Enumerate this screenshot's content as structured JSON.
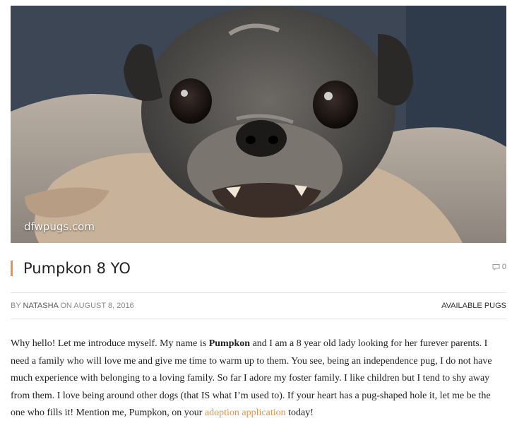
{
  "hero": {
    "watermark": "dfwpugs.com"
  },
  "post": {
    "title": "Pumpkon 8 YO",
    "comment_count": "0",
    "meta": {
      "by_label": "BY",
      "author": "NATASHA",
      "on_label": "ON",
      "date": "AUGUST 8, 2016",
      "category": "AVAILABLE PUGS"
    },
    "body": {
      "part1": "Why hello! Let me introduce myself. My name is ",
      "name_bold": "Pumpkon",
      "part2": " and I am a 8 year old lady looking for her furever parents. I need a family who will love me and give me time to warm up to them. You see, being an independence pug, I do not have much experience with belonging to a loving family. So far I adore my foster family. I like children but I tend to shy away from them. I love being around other dogs (that IS what I’m used to). If your heart has a pug-shaped hole it, let me be the one who fills it! Mention me, Pumpkon, on your ",
      "link_text": "adoption application",
      "part3": " today!"
    }
  },
  "colors": {
    "accent": "#e8914a"
  }
}
